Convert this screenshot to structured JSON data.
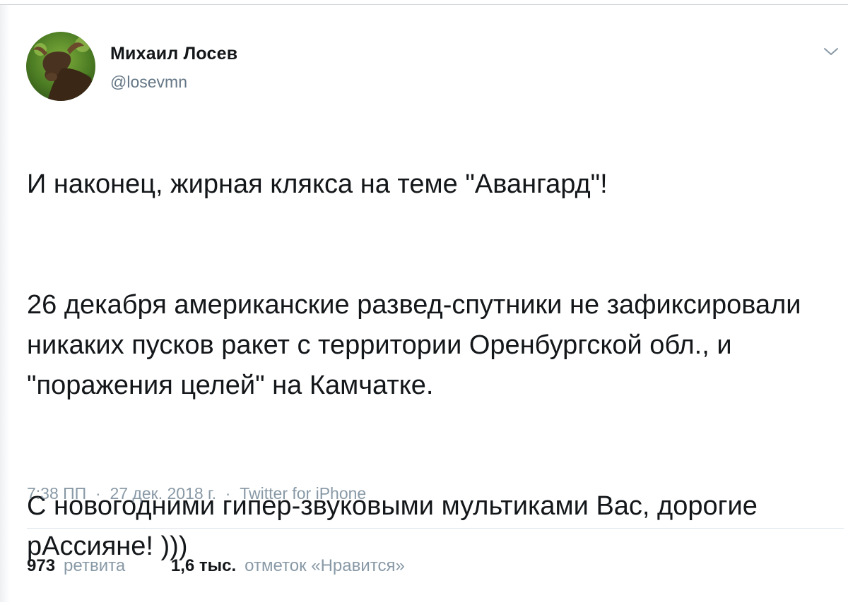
{
  "author": {
    "name": "Михаил Лосев",
    "handle": "@losevmn",
    "avatar_icon": "moose-avatar-icon"
  },
  "menu_icon": "chevron-down-icon",
  "tweet": {
    "paragraphs": [
      "И наконец, жирная клякса на теме \"Авангард\"!",
      "26 декабря американские развед-спутники не зафиксировали никаких пусков ракет с территории Оренбургской обл., и \"поражения целей\" на Камчатке.",
      "С новогодними гипер-звуковыми мультиками Вас, дорогие рАссияне! )))"
    ]
  },
  "meta": {
    "time": "7:38 ПП",
    "separator": "·",
    "date": "27 дек. 2018 г.",
    "source": "Twitter for iPhone"
  },
  "stats": {
    "retweets_count": "973",
    "retweets_label": "ретвита",
    "likes_count": "1,6 тыс.",
    "likes_label": "отметок «Нравится»"
  },
  "colors": {
    "text_primary": "#14171a",
    "text_secondary": "#657786",
    "text_muted": "#8899a6",
    "divider": "#e1e8ed"
  }
}
